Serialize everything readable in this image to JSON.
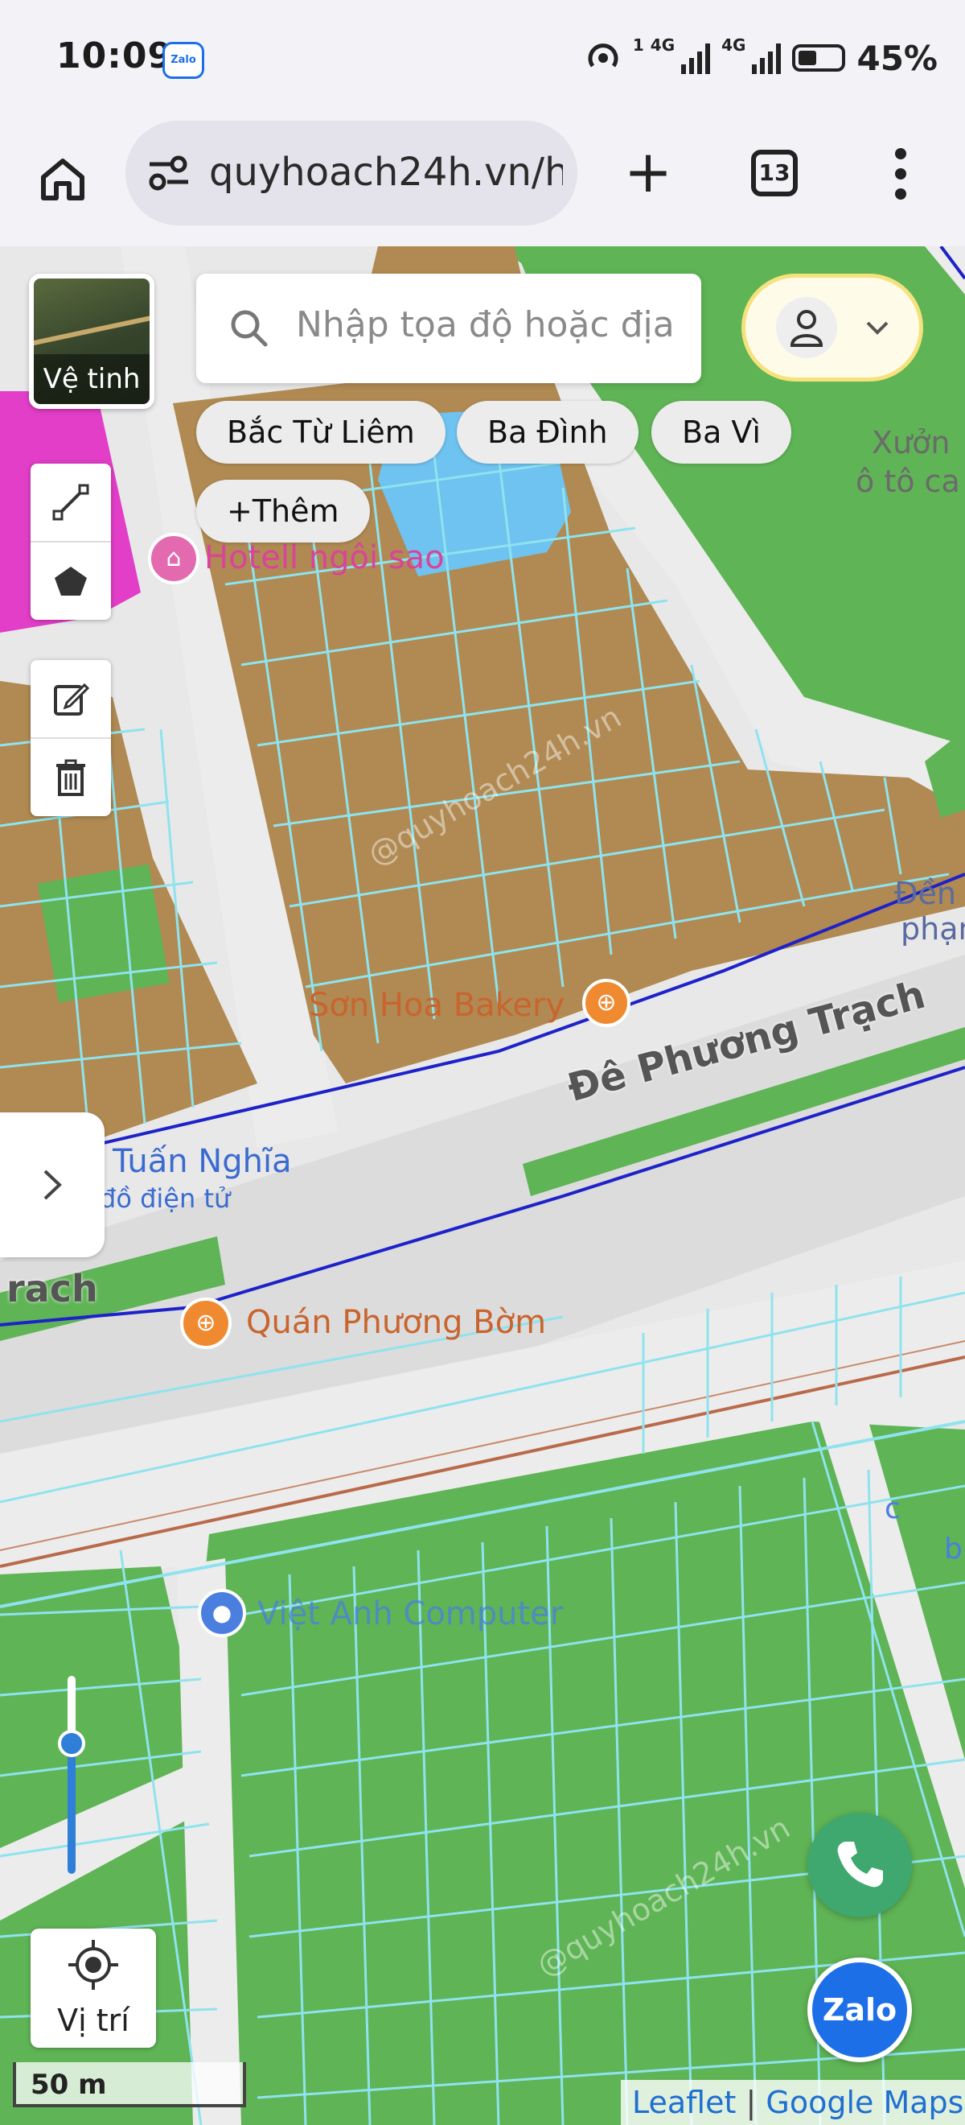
{
  "status_bar": {
    "time": "10:09",
    "notification_app": "Zalo",
    "network_1": "4G",
    "network_2": "4G",
    "sim_badge": "1",
    "battery": "45%"
  },
  "browser": {
    "url": "quyhoach24h.vn/h",
    "tab_count": "13",
    "icons": {
      "home": "home-icon",
      "site_settings": "tune-icon",
      "new_tab": "plus-icon",
      "menu": "more-vert-icon"
    }
  },
  "map": {
    "layer_button_label": "Vệ tinh",
    "search_placeholder": "Nhập tọa độ hoặc địa",
    "chips": [
      "Bắc Từ Liêm",
      "Ba Đình",
      "Ba Vì",
      "+Thêm"
    ],
    "labels": {
      "hotel": "Hotell ngôi sao",
      "bakery": "Sơn Hoa Bakery",
      "road": "Đê Phương Trạch",
      "road_left": "rach",
      "store_name": "Tuấn Nghĩa",
      "store_sub": "đồ điện tử",
      "restaurant": "Quán Phương Bờm",
      "computer": "Việt Anh Computer",
      "garage_1": "Xưởn",
      "garage_2": "ô tô ca",
      "right_1": "Đền",
      "right_2": "phạm",
      "right_3": "c",
      "right_4": "b",
      "watermark": "@quyhoach24h.vn"
    },
    "zoom_level_fraction": 0.66,
    "locate_label": "Vị trí",
    "scale_label": "50 m",
    "attribution": {
      "leaflet": "Leaflet",
      "separator": "|",
      "google": "Google Maps"
    },
    "colors": {
      "residential": "#b08a52",
      "green": "#5fb455",
      "water": "#6fc3f0",
      "commercial": "#e23ec8",
      "parcel_line": "#8fe3ee",
      "blue_line": "#1e22c8",
      "accent": "#2f7fd8",
      "phone": "#3ea86e",
      "zalo": "#1d6fe8"
    }
  }
}
